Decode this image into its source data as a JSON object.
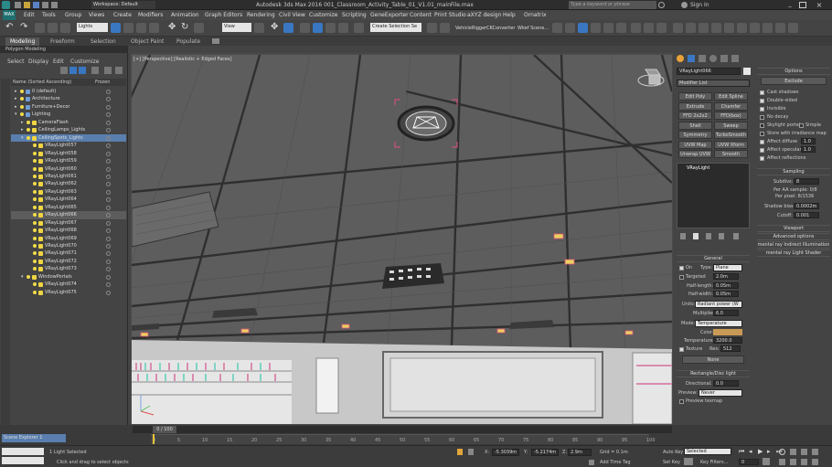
{
  "titlebar": {
    "workspace": "Workspace: Default",
    "title": "Autodesk 3ds Max 2016     001_Classroom_Activity_Table_01_V1.01_mainFile.max",
    "search_placeholder": "Type a keyword or phrase",
    "sign_in": "Sign In"
  },
  "menu": [
    "Edit",
    "Tools",
    "Group",
    "Views",
    "Create",
    "Modifiers",
    "Animation",
    "Graph Editors",
    "Rendering",
    "Civil View",
    "Customize",
    "Scripting",
    "GeneExporter",
    "Content",
    "Print Studio",
    "aXYZ design",
    "Help",
    "Ornatrix"
  ],
  "toolbar": {
    "set_combo": "Lights",
    "coord_combo": "View",
    "selection_set": "Create Selection Se",
    "labels": [
      "VehicleRigger",
      "CKConverter",
      "Wkef Scene..."
    ]
  },
  "ribbon": {
    "tabs": [
      "Modeling",
      "Freeform",
      "Selection",
      "Object Paint",
      "Populate"
    ],
    "sub": "Polygon Modeling"
  },
  "explorer": {
    "menu": [
      "Select",
      "Display",
      "Edit",
      "Customize"
    ],
    "col_name": "Name (Sorted Ascending)",
    "col_frozen": "Frozen",
    "rows": [
      {
        "name": "0 (default)",
        "lvl": 0,
        "type": "layer"
      },
      {
        "name": "Architecture",
        "lvl": 0,
        "type": "layer"
      },
      {
        "name": "Furniture+Decor",
        "lvl": 0,
        "type": "layer"
      },
      {
        "name": "Lighting",
        "lvl": 0,
        "type": "layer"
      },
      {
        "name": "CameraFlash",
        "lvl": 1,
        "type": "light"
      },
      {
        "name": "CeilingLamps_Lights",
        "lvl": 1,
        "type": "light"
      },
      {
        "name": "CeilingSpots_Lights",
        "lvl": 1,
        "type": "light",
        "sel": true
      },
      {
        "name": "VRayLight057",
        "lvl": 2,
        "type": "light"
      },
      {
        "name": "VRayLight058",
        "lvl": 2,
        "type": "light"
      },
      {
        "name": "VRayLight059",
        "lvl": 2,
        "type": "light"
      },
      {
        "name": "VRayLight060",
        "lvl": 2,
        "type": "light"
      },
      {
        "name": "VRayLight061",
        "lvl": 2,
        "type": "light"
      },
      {
        "name": "VRayLight062",
        "lvl": 2,
        "type": "light"
      },
      {
        "name": "VRayLight063",
        "lvl": 2,
        "type": "light"
      },
      {
        "name": "VRayLight064",
        "lvl": 2,
        "type": "light"
      },
      {
        "name": "VRayLight065",
        "lvl": 2,
        "type": "light"
      },
      {
        "name": "VRayLight066",
        "lvl": 2,
        "type": "light",
        "hl": true
      },
      {
        "name": "VRayLight067",
        "lvl": 2,
        "type": "light"
      },
      {
        "name": "VRayLight068",
        "lvl": 2,
        "type": "light"
      },
      {
        "name": "VRayLight069",
        "lvl": 2,
        "type": "light"
      },
      {
        "name": "VRayLight070",
        "lvl": 2,
        "type": "light"
      },
      {
        "name": "VRayLight071",
        "lvl": 2,
        "type": "light"
      },
      {
        "name": "VRayLight072",
        "lvl": 2,
        "type": "light"
      },
      {
        "name": "VRayLight073",
        "lvl": 2,
        "type": "light"
      },
      {
        "name": "WindowPortals",
        "lvl": 1,
        "type": "light"
      },
      {
        "name": "VRayLight074",
        "lvl": 2,
        "type": "light"
      },
      {
        "name": "VRayLight075",
        "lvl": 2,
        "type": "light"
      }
    ]
  },
  "viewport": {
    "label": "[+] [Perspective] [Realistic + Edged Faces]"
  },
  "command_panel": {
    "object_name": "VRayLight066",
    "modifier_list": "Modifier List",
    "buttons": [
      "Edit Poly",
      "Edit Spline",
      "Extrude",
      "Chamfer",
      "FFD 2x2x2",
      "FFD(box)",
      "Shell",
      "Sweep",
      "Symmetry",
      "TurboSmooth",
      "UVW Map",
      "UVW Xform",
      "Unwrap UVW",
      "Smooth"
    ],
    "stack_item": "VRayLight",
    "general": {
      "title": "General",
      "on": "On",
      "type_label": "Type:",
      "type_value": "Plane",
      "targeted": "Targeted",
      "target_value": "2.0m",
      "half_length_label": "Half-length:",
      "half_length": "0.05m",
      "half_width_label": "Half-width:",
      "half_width": "0.05m",
      "units_label": "Units:",
      "units_value": "Radiant power (W",
      "multiplier_label": "Multiplier:",
      "multiplier": "6.0",
      "mode_label": "Mode:",
      "mode_value": "Temperature",
      "color_label": "Color:",
      "temperature_label": "Temperature:",
      "temperature": "3200.0",
      "texture_label": "Texture",
      "res_label": "Res:",
      "res": "512",
      "none_btn": "None"
    },
    "rect": {
      "title": "Rectangle/Disc light",
      "directional_label": "Directional:",
      "directional": "0.0",
      "preview_label": "Preview:",
      "preview_value": "Never",
      "preview_texmap": "Preview texmap"
    }
  },
  "options": {
    "title": "Options",
    "exclude": "Exclude",
    "checks": [
      "Cast shadows",
      "Double-sided",
      "Invisible",
      "No decay",
      "Skylight portal",
      "Store with irradiance map",
      "Affect diffuse",
      "Affect specular",
      "Affect reflections"
    ],
    "simple": "Simple",
    "diffuse_val": "1.0",
    "specular_val": "1.0",
    "sampling_title": "Sampling",
    "subdivs_label": "Subdivs:",
    "subdivs": "8",
    "per_sample": "Per AA sample: 0/8",
    "per_pixel": "Per pixel: 8/1536",
    "shadow_bias_label": "Shadow bias:",
    "shadow_bias": "0.0002m",
    "cutoff_label": "Cutoff:",
    "cutoff": "0.001",
    "viewport": "Viewport",
    "advanced": "Advanced options",
    "mr_indirect": "mental ray Indirect Illumination",
    "mr_shader": "mental ray Light Shader"
  },
  "timeline": {
    "frame": "0 / 100",
    "ticks": [
      "0",
      "5",
      "10",
      "15",
      "20",
      "25",
      "30",
      "35",
      "40",
      "45",
      "50",
      "55",
      "60",
      "65",
      "70",
      "75",
      "80",
      "85",
      "90",
      "95",
      "100"
    ]
  },
  "status": {
    "scene_explorer": "Scene Explorer 1",
    "selected": "1 Light Selected",
    "prompt": "Click and drag to select objects",
    "x": "-5.3039m",
    "y": "-5.2174m",
    "z": "2.9m",
    "grid": "Grid = 0.1m",
    "add_time_tag": "Add Time Tag",
    "auto_key": "Auto Key",
    "set_key": "Set Key",
    "selected_combo": "Selected",
    "key_filters": "Key Filters...",
    "frame_num": "0"
  },
  "colors": {
    "selection": "#5a7fae",
    "light_icon": "#f0d542",
    "accent": "#3a77c2"
  }
}
